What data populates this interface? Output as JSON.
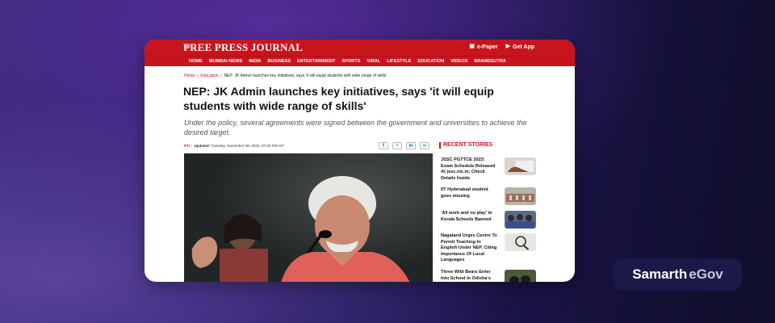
{
  "site": {
    "logo_small": "THE",
    "logo": "FREE PRESS JOURNAL",
    "actions": [
      {
        "icon": "newspaper-icon",
        "label": "e-Paper"
      },
      {
        "icon": "phone-icon",
        "label": "Get App"
      }
    ]
  },
  "nav": [
    "HOME",
    "MUMBAI NEWS",
    "INDIA",
    "BUSINESS",
    "ENTERTAINMENT",
    "SPORTS",
    "VIRAL",
    "LIFESTYLE",
    "EDUCATION",
    "VIDEOS",
    "BRANDSUTRA"
  ],
  "breadcrumb": {
    "home": "Home",
    "section": "Education",
    "current": "NEP: JK Admin launches key initiatives, says 'it will equip students with wide range of skills'",
    "sep": ">"
  },
  "article": {
    "headline": "NEP: JK Admin launches key initiatives, says 'it will equip students with wide range of skills'",
    "subhead": "Under the policy, several agreements were signed between the government and universities to achieve the desired target.",
    "author": "PTI",
    "updated_label": "Updated:",
    "updated": "Tuesday, November 29, 2022, 07:00 PM IST",
    "share": [
      "f",
      "t",
      "in",
      "w"
    ]
  },
  "sidebar": {
    "heading": "RECENT STORIES",
    "stories": [
      {
        "title": "JSSC PGTTCE 2023: Exam Schedule Released At jssc.nic.in; Check Details Inside"
      },
      {
        "title": "IIT Hyderabad student goes missing"
      },
      {
        "title": "'All work and no play' in Kerala Schools Banned"
      },
      {
        "title": "Nagaland Urges Centre To Permit Teaching In English Under NEP, Citing Importance Of Local Languages"
      },
      {
        "title": "Three Wild Bears Enter Into School in Odisha's"
      }
    ]
  },
  "brand": {
    "part1": "Samarth",
    "part2": "eGov"
  },
  "colors": {
    "accent": "#c8151d",
    "brand_bg": "#1a1948"
  }
}
